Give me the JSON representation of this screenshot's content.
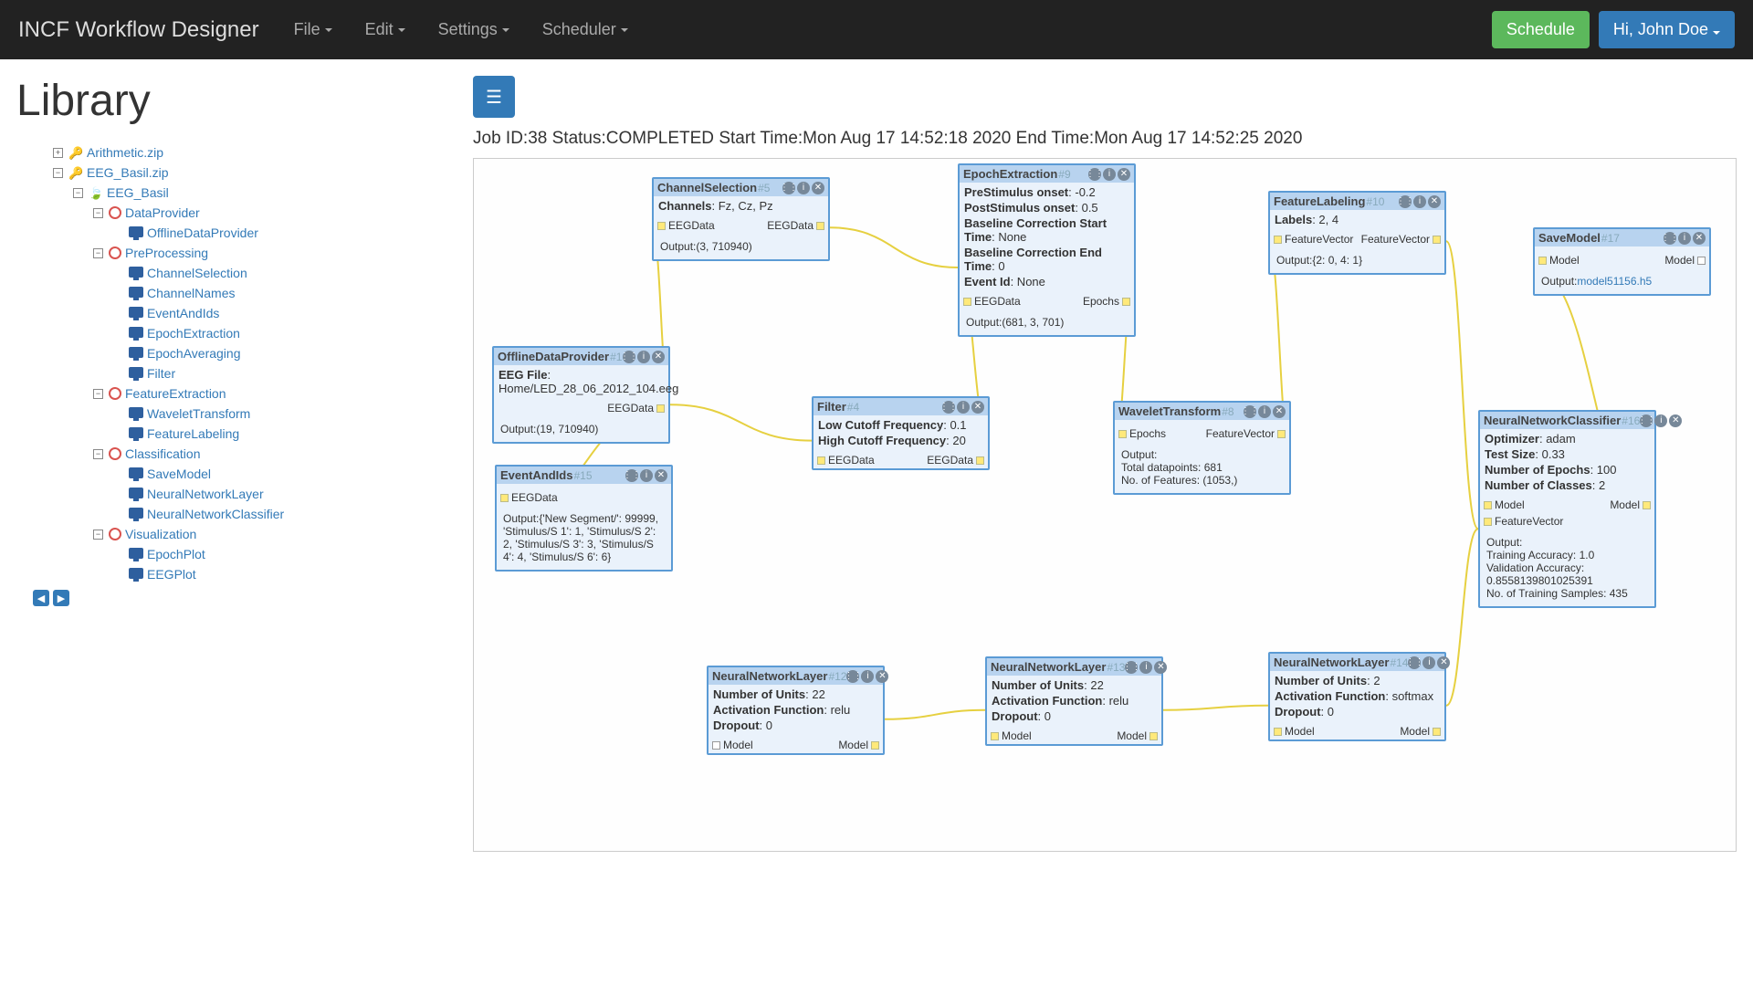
{
  "nav": {
    "brand": "INCF Workflow Designer",
    "items": [
      "File",
      "Edit",
      "Settings",
      "Scheduler"
    ],
    "schedule_btn": "Schedule",
    "user_btn": "Hi, John Doe"
  },
  "sidebar": {
    "title": "Library",
    "zips": [
      "Arithmetic.zip",
      "EEG_Basil.zip"
    ],
    "root": "EEG_Basil",
    "cats": [
      {
        "name": "DataProvider",
        "items": [
          "OfflineDataProvider"
        ]
      },
      {
        "name": "PreProcessing",
        "items": [
          "ChannelSelection",
          "ChannelNames",
          "EventAndIds",
          "EpochExtraction",
          "EpochAveraging",
          "Filter"
        ]
      },
      {
        "name": "FeatureExtraction",
        "items": [
          "WaveletTransform",
          "FeatureLabeling"
        ]
      },
      {
        "name": "Classification",
        "items": [
          "SaveModel",
          "NeuralNetworkLayer",
          "NeuralNetworkClassifier"
        ]
      },
      {
        "name": "Visualization",
        "items": [
          "EpochPlot",
          "EEGPlot"
        ]
      }
    ]
  },
  "status": {
    "job_id_label": "Job ID:",
    "job_id": "38",
    "status_label": "Status:",
    "status_val": "COMPLETED",
    "start_label": "Start Time:",
    "start_val": "Mon Aug 17 14:52:18 2020",
    "end_label": "End Time:",
    "end_val": "Mon Aug 17 14:52:25 2020"
  },
  "blocks": {
    "offline": {
      "title": "OfflineDataProvider",
      "idx": "#1",
      "params": [
        {
          "k": "EEG File",
          "v": ": Home/LED_28_06_2012_104.eeg"
        }
      ],
      "out_port": "EEGData",
      "output": "Output:(19, 710940)"
    },
    "channel": {
      "title": "ChannelSelection",
      "idx": "#5",
      "params": [
        {
          "k": "Channels",
          "v": ": Fz, Cz, Pz"
        }
      ],
      "in_port": "EEGData",
      "out_port": "EEGData",
      "output": "Output:(3, 710940)"
    },
    "epoch": {
      "title": "EpochExtraction",
      "idx": "#9",
      "params": [
        {
          "k": "PreStimulus onset",
          "v": ": -0.2"
        },
        {
          "k": "PostStimulus onset",
          "v": ": 0.5"
        },
        {
          "k": "Baseline Correction Start Time",
          "v": ": None"
        },
        {
          "k": "Baseline Correction End Time",
          "v": ": 0"
        },
        {
          "k": "Event Id",
          "v": ": None"
        }
      ],
      "in_port": "EEGData",
      "out_port": "Epochs",
      "output": "Output:(681, 3, 701)"
    },
    "flabel": {
      "title": "FeatureLabeling",
      "idx": "#10",
      "params": [
        {
          "k": "Labels",
          "v": ": 2, 4"
        }
      ],
      "in_port": "FeatureVector",
      "out_port": "FeatureVector",
      "output": "Output:{2: 0, 4: 1}"
    },
    "save": {
      "title": "SaveModel",
      "idx": "#17",
      "in_port": "Model",
      "out_port": "Model",
      "output_label": "Output:",
      "output_link": "model51156.h5"
    },
    "filter": {
      "title": "Filter",
      "idx": "#4",
      "params": [
        {
          "k": "Low Cutoff Frequency",
          "v": ": 0.1"
        },
        {
          "k": "High Cutoff Frequency",
          "v": ": 20"
        }
      ],
      "in_port": "EEGData",
      "out_port": "EEGData"
    },
    "wavelet": {
      "title": "WaveletTransform",
      "idx": "#8",
      "in_port": "Epochs",
      "out_port": "FeatureVector",
      "output": "Output:\nTotal datapoints: 681\nNo. of Features: (1053,)"
    },
    "event": {
      "title": "EventAndIds",
      "idx": "#15",
      "in_port": "EEGData",
      "output": "Output:{'New Segment/': 99999, 'Stimulus/S 1': 1, 'Stimulus/S 2': 2, 'Stimulus/S 3': 3, 'Stimulus/S 4': 4, 'Stimulus/S 6': 6}"
    },
    "nnc": {
      "title": "NeuralNetworkClassifier",
      "idx": "#16",
      "params": [
        {
          "k": "Optimizer",
          "v": ": adam"
        },
        {
          "k": "Test Size",
          "v": ": 0.33"
        },
        {
          "k": "Number of Epochs",
          "v": ": 100"
        },
        {
          "k": "Number of Classes",
          "v": ": 2"
        }
      ],
      "in_port": "Model",
      "out_port": "Model",
      "in_port2": "FeatureVector",
      "output": "Output:\nTraining Accuracy: 1.0\nValidation Accuracy: 0.8558139801025391\nNo. of Training Samples: 435"
    },
    "nn12": {
      "title": "NeuralNetworkLayer",
      "idx": "#12",
      "params": [
        {
          "k": "Number of Units",
          "v": ": 22"
        },
        {
          "k": "Activation Function",
          "v": ": relu"
        },
        {
          "k": "Dropout",
          "v": ": 0"
        }
      ],
      "in_port": "Model",
      "out_port": "Model",
      "in_white": true
    },
    "nn13": {
      "title": "NeuralNetworkLayer",
      "idx": "#13",
      "params": [
        {
          "k": "Number of Units",
          "v": ": 22"
        },
        {
          "k": "Activation Function",
          "v": ": relu"
        },
        {
          "k": "Dropout",
          "v": ": 0"
        }
      ],
      "in_port": "Model",
      "out_port": "Model"
    },
    "nn14": {
      "title": "NeuralNetworkLayer",
      "idx": "#14",
      "params": [
        {
          "k": "Number of Units",
          "v": ": 2"
        },
        {
          "k": "Activation Function",
          "v": ": softmax"
        },
        {
          "k": "Dropout",
          "v": ": 0"
        }
      ],
      "in_port": "Model",
      "out_port": "Model"
    }
  }
}
